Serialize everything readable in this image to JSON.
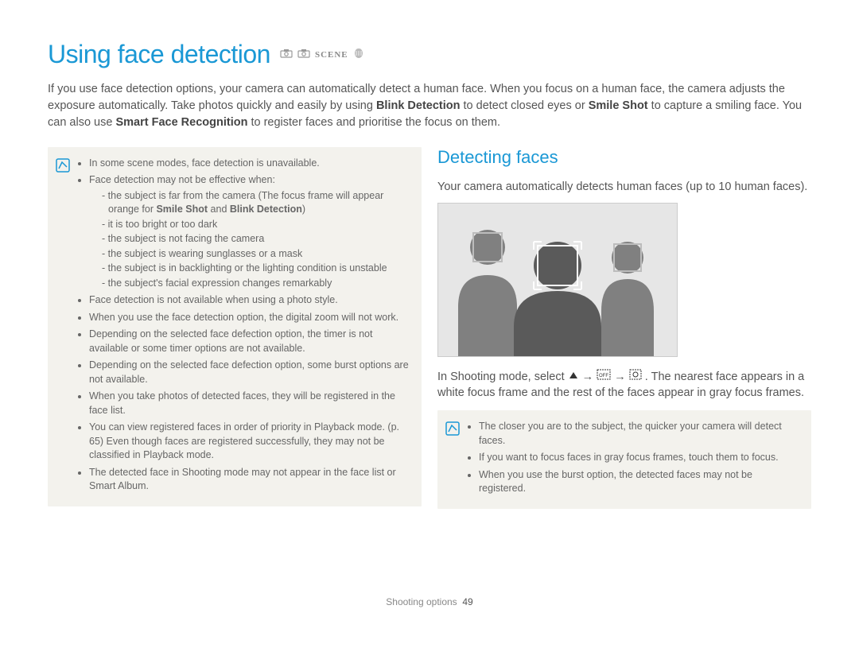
{
  "title": "Using face detection",
  "mode_icons": [
    "camera-icon",
    "camera-icon",
    "SCENE",
    "dual-icon"
  ],
  "intro": {
    "part1": "If you use face detection options, your camera can automatically detect a human face. When you focus on a human face, the camera adjusts the exposure automatically. Take photos quickly and easily by using ",
    "bold1": "Blink Detection",
    "part2": " to detect closed eyes or ",
    "bold2": "Smile Shot",
    "part3": " to capture a smiling face. You can also use ",
    "bold3": "Smart Face Recognition",
    "part4": " to register faces and prioritise the focus on them."
  },
  "left_note": {
    "b1": "In some scene modes, face detection is unavailable.",
    "b2": "Face detection may not be effective when:",
    "sub": [
      {
        "pre": "the subject is far from the camera (The focus frame will appear orange for ",
        "bold1": "Smile Shot",
        "mid": " and ",
        "bold2": "Blink Detection",
        "post": ")"
      },
      {
        "text": "it is too bright or too dark"
      },
      {
        "text": "the subject is not facing the camera"
      },
      {
        "text": "the subject is wearing sunglasses or a mask"
      },
      {
        "text": "the subject is in backlighting or the lighting condition is unstable"
      },
      {
        "text": "the subject's facial expression changes remarkably"
      }
    ],
    "rest": [
      "Face detection is not available when using a photo style.",
      "When you use the face detection option, the digital zoom will not work.",
      "Depending on the selected face defection option, the timer is not available or some timer options are not available.",
      "Depending on the selected face defection option, some burst options are not available.",
      "When you take photos of detected faces, they will be registered in the face list.",
      "You can view registered faces in order of priority in Playback mode. (p. 65) Even though faces are registered successfully, they may not be classified in Playback mode.",
      "The detected face in Shooting mode may not appear in the face list or Smart Album."
    ]
  },
  "right": {
    "heading": "Detecting faces",
    "lead": "Your camera automatically detects human faces (up to 10 human faces).",
    "instruction": {
      "pre": "In Shooting mode, select ",
      "arrow": "→",
      "post": ". The nearest face appears in a white focus frame and the rest of the faces appear in gray focus frames."
    },
    "note": [
      "The closer you are to the subject, the quicker your camera will detect faces.",
      "If you want to focus faces in gray focus frames, touch them to focus.",
      "When you use the burst option, the detected faces may not be registered."
    ]
  },
  "footer": {
    "section": "Shooting options",
    "page": "49"
  }
}
